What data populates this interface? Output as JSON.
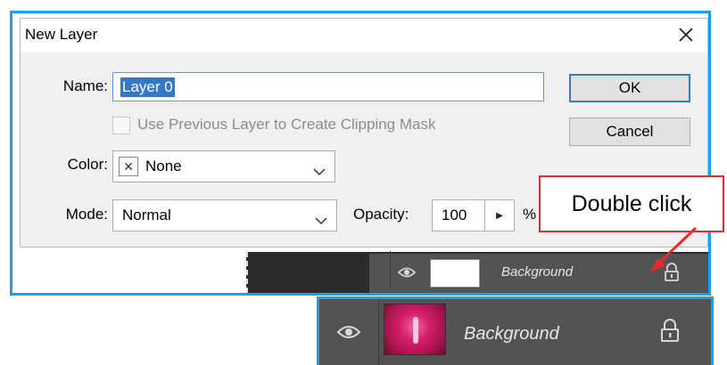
{
  "dialog": {
    "title": "New Layer",
    "name_label": "Name:",
    "name_value": "Layer 0",
    "clipping_label": "Use Previous Layer to Create Clipping Mask",
    "clipping_checked": false,
    "color_label": "Color:",
    "color_value": "None",
    "mode_label": "Mode:",
    "mode_value": "Normal",
    "opacity_label": "Opacity:",
    "opacity_value": "100",
    "opacity_unit": "%",
    "ok_label": "OK",
    "cancel_label": "Cancel"
  },
  "layers_panel_top": {
    "layer_name": "Background"
  },
  "layers_panel_bottom": {
    "layer_name": "Background"
  },
  "callout": {
    "text": "Double click"
  },
  "colors": {
    "frame_border": "#1ea0e6",
    "callout_border": "#e52b2b",
    "panel_bg": "#535353",
    "ok_focus": "#2b7fd1"
  }
}
